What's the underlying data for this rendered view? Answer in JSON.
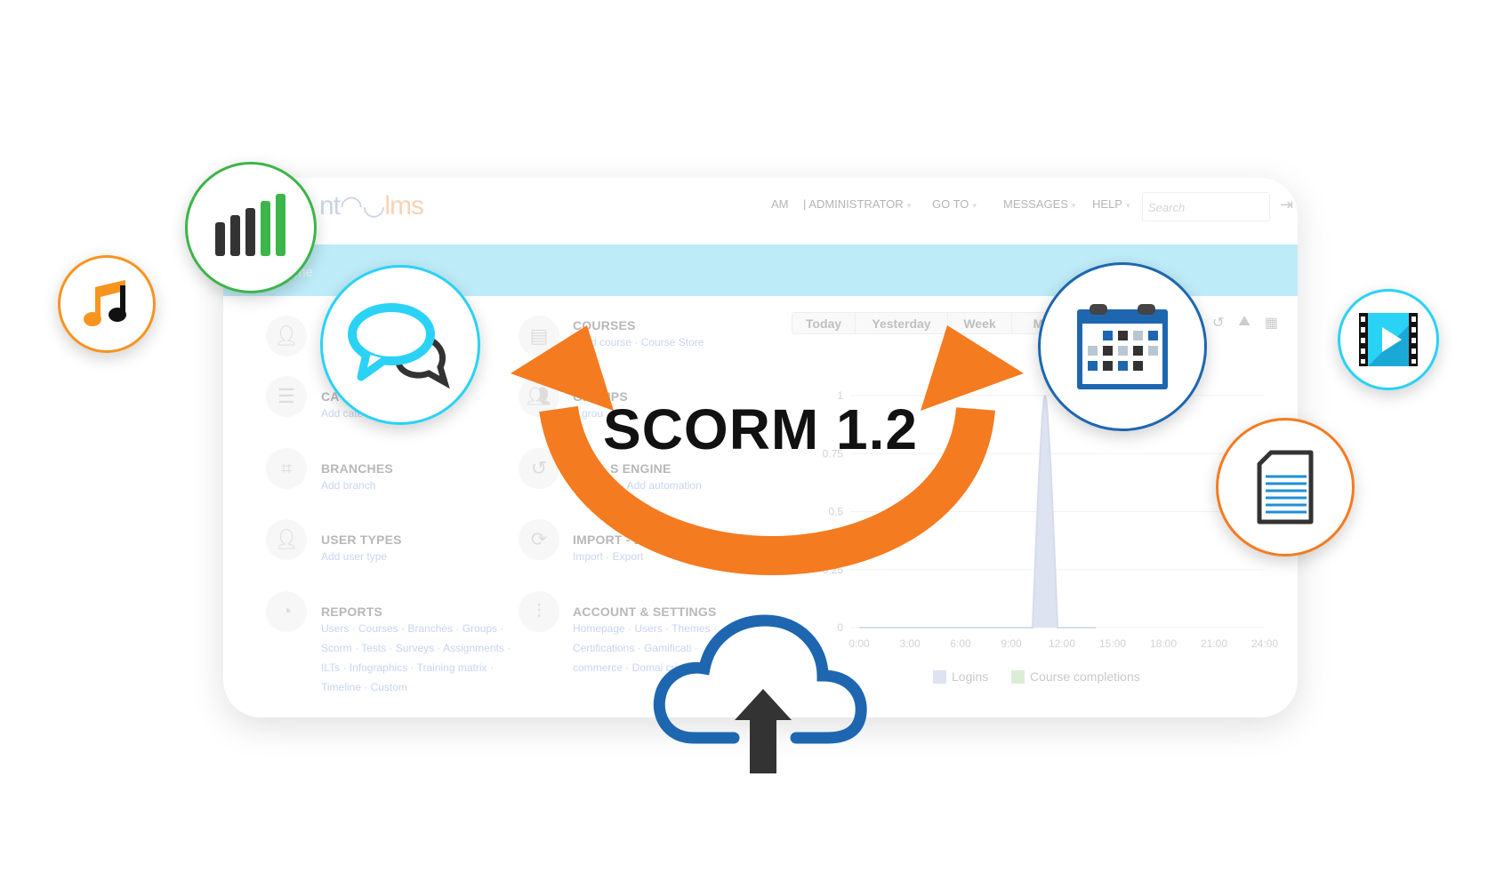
{
  "header": {
    "logo_left": "nt",
    "logo_right": "lms",
    "user": "AM",
    "role": "| ADMINISTRATOR",
    "goto": "GO TO",
    "messages": "MESSAGES",
    "help": "HELP",
    "search_placeholder": "Search"
  },
  "band": {
    "title": "me"
  },
  "admin_left": [
    {
      "title": "",
      "links": ""
    },
    {
      "title": "CA",
      "links": "Add cate"
    },
    {
      "title": "BRANCHES",
      "links": "Add branch"
    },
    {
      "title": "USER TYPES",
      "links": "Add user type"
    },
    {
      "title": "REPORTS",
      "links": "Users · Courses · Branches · Groups · Scorm · Tests · Surveys · Assignments · ILTs · Infographics · Training matrix · Timeline · Custom"
    }
  ],
  "admin_right": [
    {
      "title": "COURSES",
      "links": "d course · Course Store"
    },
    {
      "title": "GROUPS",
      "links": "d grou"
    },
    {
      "title": "S ENGINE",
      "links": "Add    ation · Add automation"
    },
    {
      "title": "IMPORT - EXPOR",
      "links": "Import · Export"
    },
    {
      "title": "ACCOUNT & SETTINGS",
      "links": "Homepage · Users · Themes · Certifications · Gamificati · commerce · Domai   cription"
    }
  ],
  "chart_tabs": [
    "Today",
    "Yesterday",
    "Week",
    "M"
  ],
  "chart_data": {
    "type": "area",
    "x": [
      "0:00",
      "1:00",
      "2:00",
      "3:00",
      "4:00",
      "5:00",
      "6:00",
      "7:00",
      "8:00",
      "9:00",
      "10:00",
      "11:00",
      "12:00",
      "13:00",
      "14:00"
    ],
    "series": [
      {
        "name": "Logins",
        "values": [
          0,
          0,
          0,
          0,
          0,
          0,
          0,
          0,
          0,
          0,
          0,
          1,
          0,
          0,
          0
        ],
        "color": "#dde3f0"
      },
      {
        "name": "Course completions",
        "values": [],
        "color": "#dcedd6"
      }
    ],
    "xticks": [
      "0:00",
      "3:00",
      "6:00",
      "9:00",
      "12:00",
      "15:00",
      "18:00",
      "21:00",
      "24:00"
    ],
    "yticks": [
      "0",
      "0.25",
      "0.5",
      "0.75",
      "1"
    ],
    "xlim": [
      0,
      24
    ],
    "ylim": [
      0,
      1
    ],
    "grid": true,
    "legend": "bottom"
  },
  "overlay": {
    "headline": "SCORM 1.2",
    "arrow_color": "#f47b20",
    "icons": [
      "music-note",
      "signal-bars",
      "chat-bubbles",
      "calendar",
      "film-play",
      "document",
      "cloud-upload"
    ]
  }
}
